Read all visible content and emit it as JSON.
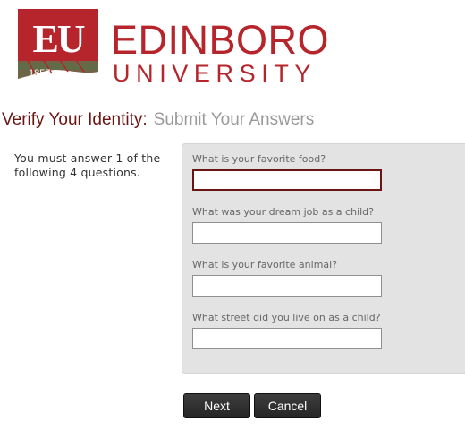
{
  "logo": {
    "monogram": "EU",
    "year": "1857",
    "wordmark_top": "EDINBORO",
    "wordmark_bottom": "UNIVERSITY",
    "brand_color": "#b5252b"
  },
  "heading": {
    "main": "Verify Your Identity:",
    "sub": "Submit Your Answers"
  },
  "instructions": "You must answer 1 of the following 4 questions.",
  "questions": [
    {
      "label": "What is your favorite food?",
      "value": "",
      "focused": true
    },
    {
      "label": "What was your dream job as a child?",
      "value": ""
    },
    {
      "label": "What is your favorite animal?",
      "value": ""
    },
    {
      "label": "What street did you live on as a child?",
      "value": ""
    }
  ],
  "buttons": {
    "next": "Next",
    "cancel": "Cancel"
  },
  "colors": {
    "accent": "#6b1513",
    "panel_bg": "#e3e3e3",
    "button_bg": "#2f2f2f"
  }
}
